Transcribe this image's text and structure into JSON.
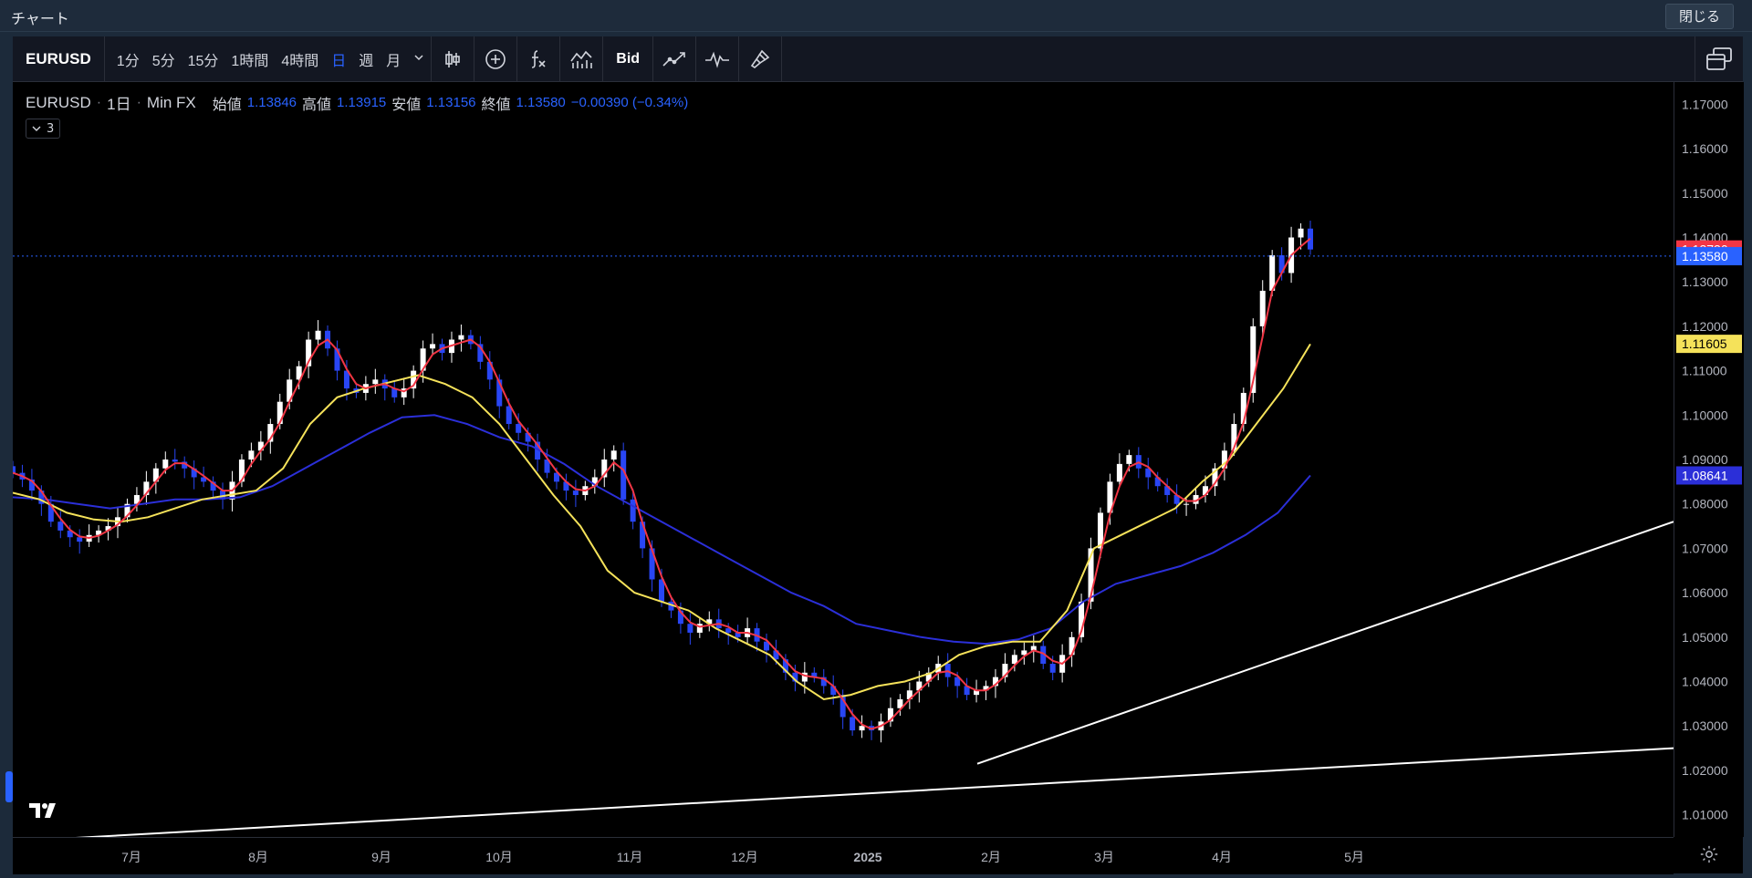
{
  "window": {
    "title": "チャート",
    "close_label": "閉じる"
  },
  "toolbar": {
    "symbol": "EURUSD",
    "intervals": [
      "1分",
      "5分",
      "15分",
      "1時間",
      "4時間",
      "日",
      "週",
      "月"
    ],
    "active_interval": "日",
    "bid_label": "Bid",
    "icons": [
      "candle-style-icon",
      "add-indicator-icon",
      "function-icon",
      "indicator-template-icon",
      "compare-icon",
      "alert-wave-icon",
      "brush-icon",
      "layout-icon"
    ]
  },
  "legend": {
    "symbol": "EURUSD",
    "interval": "1日",
    "source": "Min FX",
    "open_label": "始値",
    "open": "1.13846",
    "high_label": "高値",
    "high": "1.13915",
    "low_label": "安値",
    "low": "1.13156",
    "close_label": "終値",
    "close": "1.13580",
    "change": "−0.00390 (−0.34%)",
    "collapsed_count": "3"
  },
  "colors": {
    "up": "#ffffff",
    "down": "#2946f5",
    "ma_red": "#f23645",
    "ma_yellow": "#f5e25a",
    "ma_blue": "#2b2fd8",
    "trendline": "#ffffff"
  },
  "chart_data": {
    "type": "candlestick",
    "title": "",
    "y_ticks": [
      "1.17000",
      "1.16000",
      "1.15000",
      "1.14000",
      "1.13000",
      "1.12000",
      "1.11000",
      "1.10000",
      "1.09000",
      "1.08000",
      "1.07000",
      "1.06000",
      "1.05000",
      "1.04000",
      "1.03000",
      "1.02000",
      "1.01000"
    ],
    "y_range": [
      1.005,
      1.175
    ],
    "x_ticks": [
      "7月",
      "8月",
      "9月",
      "10月",
      "11月",
      "12月",
      "2025",
      "2月",
      "3月",
      "4月",
      "5月"
    ],
    "price_labels": [
      {
        "value": "1.13730",
        "color": "#f23645"
      },
      {
        "value": "1.13580",
        "color": "#2962ff"
      },
      {
        "value": "1.11605",
        "color": "#f5e25a"
      },
      {
        "value": "1.08641",
        "color": "#2b2fd8"
      }
    ],
    "series": [
      {
        "name": "",
        "closes": [
          1.087,
          1.0855,
          1.083,
          1.08,
          1.076,
          1.074,
          1.0725,
          1.0715,
          1.073,
          1.074,
          1.075,
          1.077,
          1.08,
          1.082,
          1.085,
          1.088,
          1.09,
          1.0895,
          1.088,
          1.086,
          1.085,
          1.083,
          1.081,
          1.085,
          1.09,
          1.092,
          1.094,
          1.098,
          1.103,
          1.108,
          1.111,
          1.117,
          1.119,
          1.115,
          1.11,
          1.106,
          1.105,
          1.107,
          1.108,
          1.106,
          1.104,
          1.106,
          1.11,
          1.115,
          1.116,
          1.114,
          1.117,
          1.118,
          1.116,
          1.112,
          1.108,
          1.102,
          1.098,
          1.096,
          1.094,
          1.09,
          1.087,
          1.085,
          1.083,
          1.082,
          1.084,
          1.086,
          1.09,
          1.092,
          1.081,
          1.076,
          1.07,
          1.063,
          1.058,
          1.056,
          1.053,
          1.051,
          1.053,
          1.054,
          1.052,
          1.051,
          1.05,
          1.052,
          1.049,
          1.047,
          1.045,
          1.042,
          1.04,
          1.042,
          1.041,
          1.039,
          1.037,
          1.032,
          1.029,
          1.03,
          1.029,
          1.031,
          1.034,
          1.036,
          1.038,
          1.04,
          1.042,
          1.044,
          1.041,
          1.039,
          1.037,
          1.038,
          1.039,
          1.041,
          1.044,
          1.046,
          1.047,
          1.048,
          1.044,
          1.042,
          1.046,
          1.05,
          1.058,
          1.07,
          1.078,
          1.085,
          1.089,
          1.091,
          1.088,
          1.086,
          1.084,
          1.082,
          1.08,
          1.08,
          1.082,
          1.084,
          1.088,
          1.092,
          1.098,
          1.105,
          1.12,
          1.128,
          1.136,
          1.132,
          1.14,
          1.142,
          1.1373
        ]
      },
      {
        "name": "",
        "values": [
          1.0825,
          1.081,
          1.078,
          1.0765,
          1.076,
          1.077,
          1.079,
          1.081,
          1.082,
          1.083,
          1.088,
          1.098,
          1.104,
          1.106,
          1.1075,
          1.109,
          1.107,
          1.104,
          1.098,
          1.09,
          1.082,
          1.075,
          1.065,
          1.06,
          1.058,
          1.056,
          1.052,
          1.049,
          1.046,
          1.04,
          1.036,
          1.037,
          1.039,
          1.04,
          1.042,
          1.046,
          1.048,
          1.049,
          1.049,
          1.056,
          1.07,
          1.073,
          1.076,
          1.079,
          1.085,
          1.09,
          1.098,
          1.106,
          1.116
        ]
      },
      {
        "name": "",
        "values": [
          1.0815,
          1.081,
          1.08,
          1.079,
          1.08,
          1.081,
          1.081,
          1.0815,
          1.084,
          1.088,
          1.092,
          1.096,
          1.0995,
          1.1,
          1.098,
          1.095,
          1.093,
          1.089,
          1.084,
          1.08,
          1.076,
          1.072,
          1.068,
          1.064,
          1.06,
          1.057,
          1.053,
          1.0515,
          1.05,
          1.049,
          1.0485,
          1.0495,
          1.052,
          1.058,
          1.062,
          1.064,
          1.066,
          1.069,
          1.073,
          1.078,
          1.0864
        ]
      }
    ],
    "trendlines": [
      {
        "from": [
          "2024-06",
          1.004
        ],
        "to": [
          "2025-04",
          1.025
        ]
      },
      {
        "from": [
          "2025-02",
          1.0215
        ],
        "to": [
          "2025-04",
          1.076
        ]
      }
    ]
  }
}
